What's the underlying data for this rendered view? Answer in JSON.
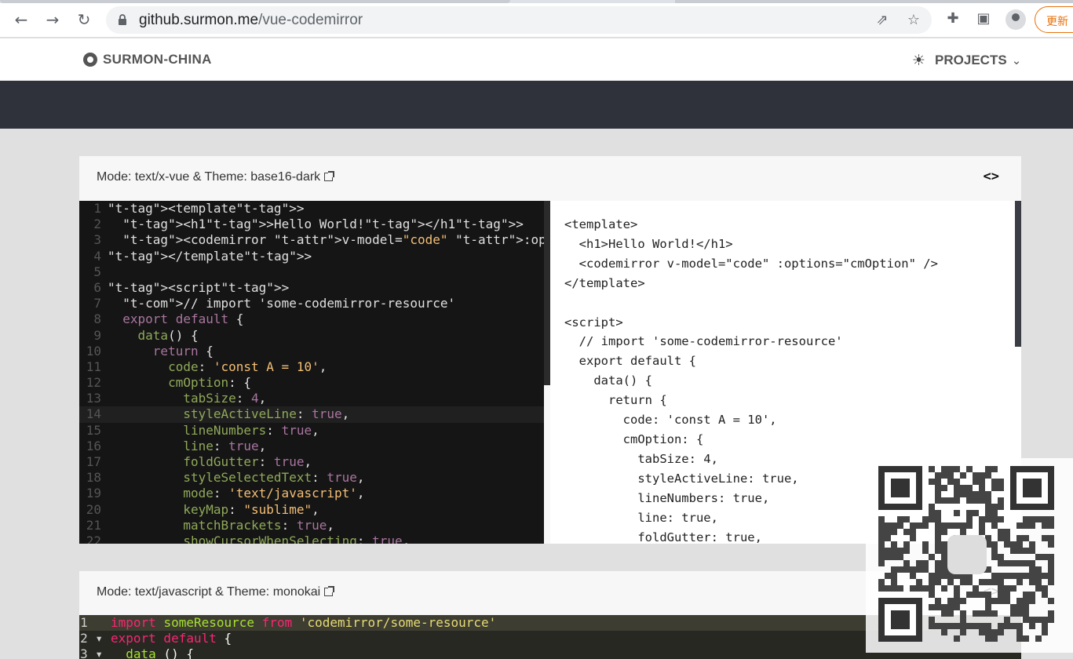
{
  "browser": {
    "url_host": "github.surmon.me",
    "url_path": "/vue-codemirror",
    "update_label": "更新"
  },
  "site": {
    "brand": "SURMON-CHINA",
    "projects": "PROJECTS"
  },
  "cards": [
    {
      "title": "Mode: text/x-vue & Theme: base16-dark",
      "toggle": "<>",
      "code_lines": [
        "<template>",
        "  <h1>Hello World!</h1>",
        "  <codemirror v-model=\"code\" :options=\"cmOption\" />",
        "</template>",
        "",
        "<script>",
        "  // import 'some-codemirror-resource'",
        "  export default {",
        "    data() {",
        "      return {",
        "        code: 'const A = 10',",
        "        cmOption: {",
        "          tabSize: 4,",
        "          styleActiveLine: true,",
        "          lineNumbers: true,",
        "          line: true,",
        "          foldGutter: true,",
        "          styleSelectedText: true,",
        "          mode: 'text/javascript',",
        "          keyMap: \"sublime\",",
        "          matchBrackets: true,",
        "          showCursorWhenSelecting: true,"
      ],
      "preview_text": "<template>\n  <h1>Hello World!</h1>\n  <codemirror v-model=\"code\" :options=\"cmOption\" />\n</template>\n\n<script>\n  // import 'some-codemirror-resource'\n  export default {\n    data() {\n      return {\n        code: 'const A = 10',\n        cmOption: {\n          tabSize: 4,\n          styleActiveLine: true,\n          lineNumbers: true,\n          line: true,\n          foldGutter: true,"
    },
    {
      "title": "Mode: text/javascript & Theme: monokai",
      "toggle": "<>",
      "code_lines": [
        "import someResource from 'codemirror/some-resource'",
        "export default {",
        "  data () {"
      ]
    }
  ],
  "colors": {
    "base16_bg": "#151515",
    "monokai_bg": "#272822",
    "banner": "#2f323a",
    "update_accent": "#e8710a"
  },
  "icons": [
    "back-icon",
    "forward-icon",
    "reload-icon",
    "lock-icon",
    "share-icon",
    "star-icon",
    "extensions-icon",
    "sidepanel-icon",
    "profile-icon",
    "github-icon",
    "sun-icon",
    "chevron-down-icon",
    "external-link-icon",
    "code-toggle-icon",
    "qr-code"
  ]
}
